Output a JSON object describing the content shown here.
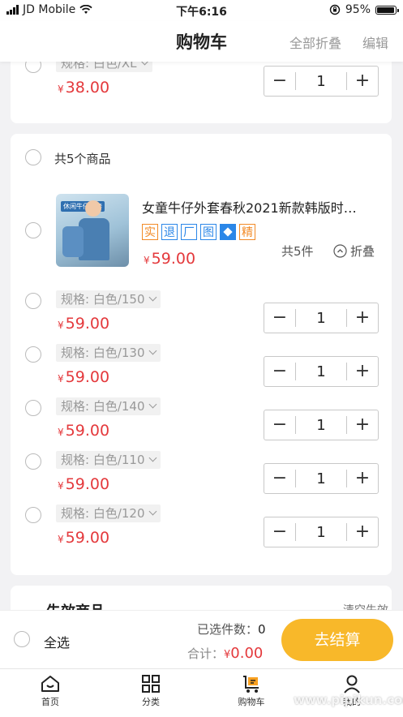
{
  "status_bar": {
    "carrier": "JD Mobile",
    "time": "下午6:16",
    "battery": "95%",
    "battery_level": 0.95
  },
  "header": {
    "title": "购物车",
    "fold_all": "全部折叠",
    "edit": "编辑"
  },
  "prev_card": {
    "spec": "规格: 白色/XL",
    "price_symbol": "¥",
    "price": "38.00",
    "quantity": "1"
  },
  "group": {
    "total_label": "共5个商品",
    "product": {
      "title": "女童牛仔外套春秋2021新款韩版时…",
      "image_caption": "休闲牛仔外套",
      "tags": [
        "实",
        "退",
        "厂",
        "图",
        "精"
      ],
      "price_symbol": "¥",
      "price": "59.00",
      "count": "共5件",
      "collapse": "折叠"
    },
    "variants": [
      {
        "spec": "规格: 白色/150",
        "price": "59.00",
        "quantity": "1"
      },
      {
        "spec": "规格: 白色/130",
        "price": "59.00",
        "quantity": "1"
      },
      {
        "spec": "规格: 白色/140",
        "price": "59.00",
        "quantity": "1"
      },
      {
        "spec": "规格: 白色/110",
        "price": "59.00",
        "quantity": "1"
      },
      {
        "spec": "规格: 白色/120",
        "price": "59.00",
        "quantity": "1"
      }
    ]
  },
  "invalid_section": {
    "title": "失效商品",
    "clear": "清空失效"
  },
  "summary": {
    "select_all": "全选",
    "selected_label": "已选件数：",
    "selected_count": "0",
    "total_label": "合计：",
    "total_symbol": "¥",
    "total": "0.00",
    "checkout": "去结算"
  },
  "tabs": [
    {
      "label": "首页",
      "icon": "home-icon"
    },
    {
      "label": "分类",
      "icon": "grid-icon"
    },
    {
      "label": "购物车",
      "icon": "cart-icon",
      "active": true
    },
    {
      "label": "我的",
      "icon": "person-icon"
    }
  ],
  "watermark": "www.pipikun.com",
  "colors": {
    "price_red": "#e4393c",
    "checkout_yellow": "#f8b82a",
    "tag_orange": "#f28a26",
    "tag_blue": "#2b87e8"
  }
}
